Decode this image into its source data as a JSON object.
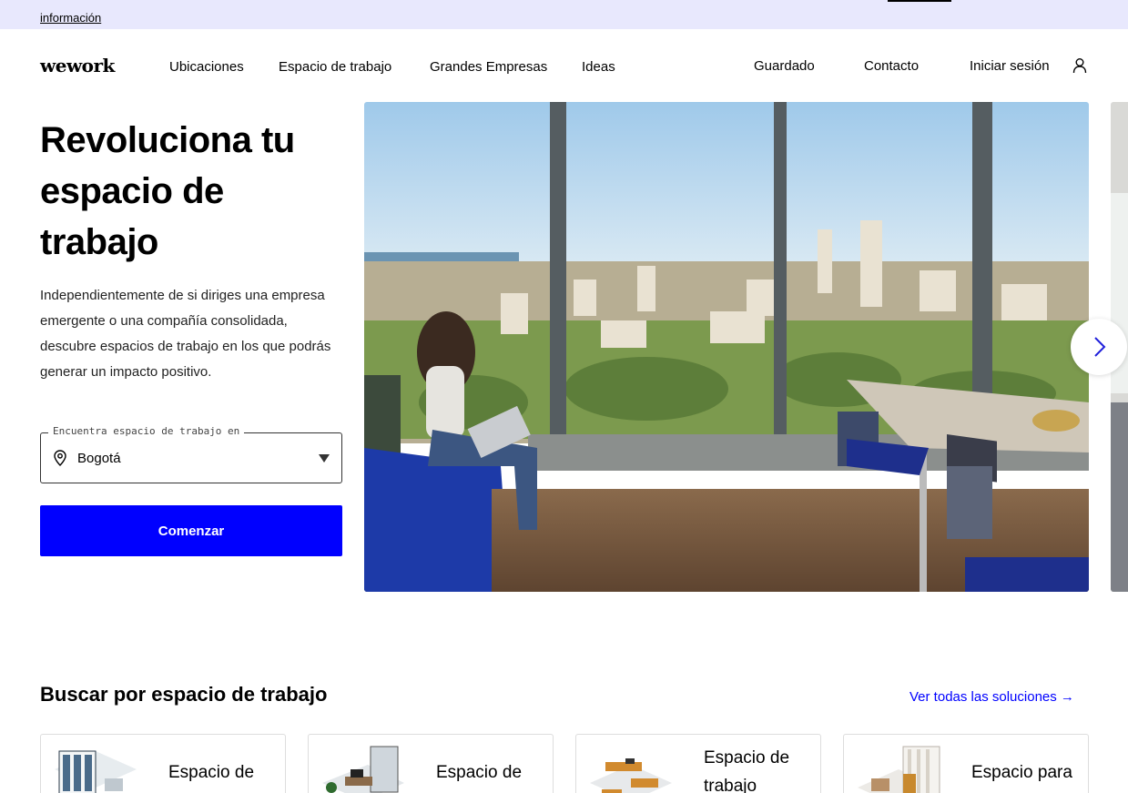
{
  "banner": {
    "link_text": "información"
  },
  "header": {
    "logo_text": "wework",
    "nav_left": [
      {
        "label": "Ubicaciones"
      },
      {
        "label": "Espacio de trabajo"
      },
      {
        "label": "Grandes Empresas"
      },
      {
        "label": "Ideas"
      }
    ],
    "nav_right": [
      {
        "label": "Guardado"
      },
      {
        "label": "Contacto"
      },
      {
        "label": "Iniciar sesión"
      }
    ],
    "user_icon": "user-icon"
  },
  "hero": {
    "title": "Revoluciona tu espacio de trabajo",
    "description": "Independientemente de si diriges una empresa emergente o una compañía consolidada, descubre espacios de trabajo en los que podrás generar un impacto positivo.",
    "location_field": {
      "label": "Encuentra espacio de trabajo en",
      "value": "Bogotá",
      "icon": "map-pin-icon"
    },
    "cta_label": "Comenzar",
    "carousel_next_icon": "chevron-right-icon"
  },
  "solutions": {
    "title": "Buscar por espacio de trabajo",
    "see_all": "Ver todas las soluciones →",
    "cards": [
      {
        "title": "Espacio de"
      },
      {
        "title": "Espacio de"
      },
      {
        "title": "Espacio de trabajo"
      },
      {
        "title": "Espacio para"
      }
    ]
  },
  "colors": {
    "banner_bg": "#e8e8fd",
    "accent_blue": "#0000ff",
    "text": "#000000"
  }
}
